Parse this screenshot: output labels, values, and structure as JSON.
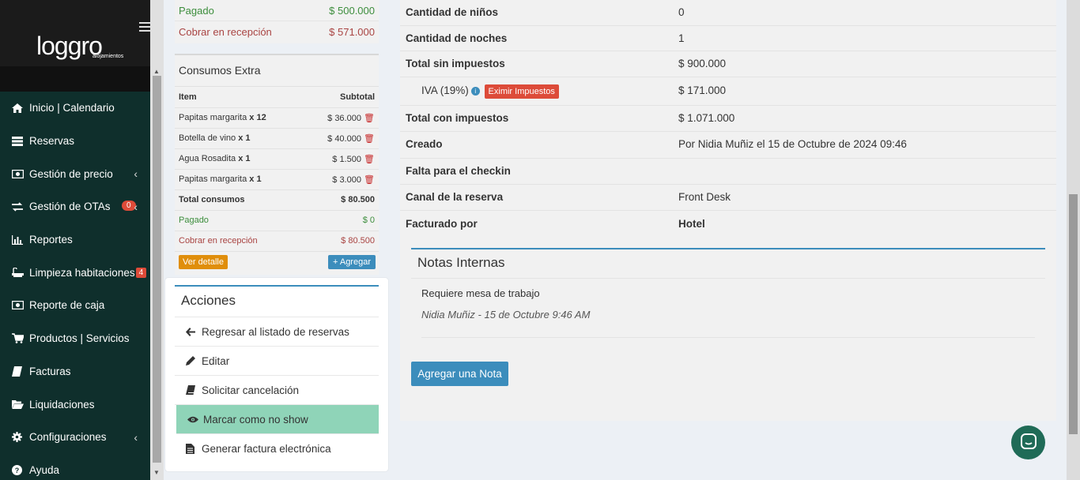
{
  "sidebar": {
    "logo_text": "loggro",
    "logo_sub": "alojamientos",
    "items": [
      {
        "label": "Inicio | Calendario",
        "icon": "home-icon"
      },
      {
        "label": "Reservas",
        "icon": "list-icon"
      },
      {
        "label": "Gestión de precio",
        "icon": "money-icon",
        "chevron": "‹"
      },
      {
        "label": "Gestión de OTAs",
        "icon": "exchange-icon",
        "badge": "0",
        "chevron": "‹"
      },
      {
        "label": "Reportes",
        "icon": "bar-chart-icon"
      },
      {
        "label": "Limpieza habitaciones",
        "icon": "bath-icon",
        "badge": "4"
      },
      {
        "label": "Reporte de caja",
        "icon": "money-icon"
      },
      {
        "label": "Productos | Servicios",
        "icon": "cart-icon"
      },
      {
        "label": "Facturas",
        "icon": "book-icon"
      },
      {
        "label": "Liquidaciones",
        "icon": "folder-open-icon"
      },
      {
        "label": "Configuraciones",
        "icon": "gear-icon",
        "chevron": "‹"
      },
      {
        "label": "Ayuda",
        "icon": "question-circle-icon"
      }
    ]
  },
  "payment_summary": {
    "paid_label": "Pagado",
    "paid_value": "$ 500.000",
    "due_label": "Cobrar en recepción",
    "due_value": "$ 571.000"
  },
  "extras": {
    "title": "Consumos Extra",
    "col_item": "Item",
    "col_subtotal": "Subtotal",
    "rows": [
      {
        "name": "Papitas margarita",
        "qty": "x 12",
        "subtotal": "$ 36.000"
      },
      {
        "name": "Botella de vino",
        "qty": "x 1",
        "subtotal": "$ 40.000"
      },
      {
        "name": "Agua Rosadita",
        "qty": "x 1",
        "subtotal": "$ 1.500"
      },
      {
        "name": "Papitas margarita",
        "qty": "x 1",
        "subtotal": "$ 3.000"
      }
    ],
    "total_label": "Total consumos",
    "total_value": "$ 80.500",
    "paid_label": "Pagado",
    "paid_value": "$ 0",
    "due_label": "Cobrar en recepción",
    "due_value": "$ 80.500",
    "detail_button": "Ver detalle",
    "add_button": "+ Agregar"
  },
  "actions": {
    "title": "Acciones",
    "items": [
      {
        "label": "Regresar al listado de reservas",
        "icon": "arrow-left-icon"
      },
      {
        "label": "Editar",
        "icon": "pencil-icon"
      },
      {
        "label": "Solicitar cancelación",
        "icon": "book-icon"
      },
      {
        "label": "Marcar como no show",
        "icon": "eye-icon"
      },
      {
        "label": "Generar factura electrónica",
        "icon": "file-text-icon"
      }
    ]
  },
  "details": {
    "children_label": "Cantidad de niños",
    "children_value": "0",
    "nights_label": "Cantidad de noches",
    "nights_value": "1",
    "subtotal_label": "Total sin impuestos",
    "subtotal_value": "$ 900.000",
    "iva_label": "IVA (19%)",
    "exempt_button": "Eximir Impuestos",
    "iva_value": "$ 171.000",
    "total_label": "Total con impuestos",
    "total_value": "$ 1.071.000",
    "created_label": "Creado",
    "created_value": "Por Nidia Muñiz el 15 de Octubre de 2024 09:46",
    "checkin_label": "Falta para el checkin",
    "checkin_value": "",
    "channel_label": "Canal de la reserva",
    "channel_value": "Front Desk",
    "billed_label": "Facturado por",
    "billed_value": "Hotel"
  },
  "notes": {
    "title": "Notas Internas",
    "text": "Requiere mesa de trabajo",
    "meta": "Nidia Muñiz - 15 de Octubre 9:46 AM",
    "add_button": "Agregar una Nota"
  },
  "colors": {
    "sidebar_bg": "#0f2f2c",
    "primary": "#3c8dbc",
    "danger": "#dd4b39",
    "warning": "#e08e0b",
    "highlight": "#8fd4b8",
    "chat": "#1f6b57"
  }
}
